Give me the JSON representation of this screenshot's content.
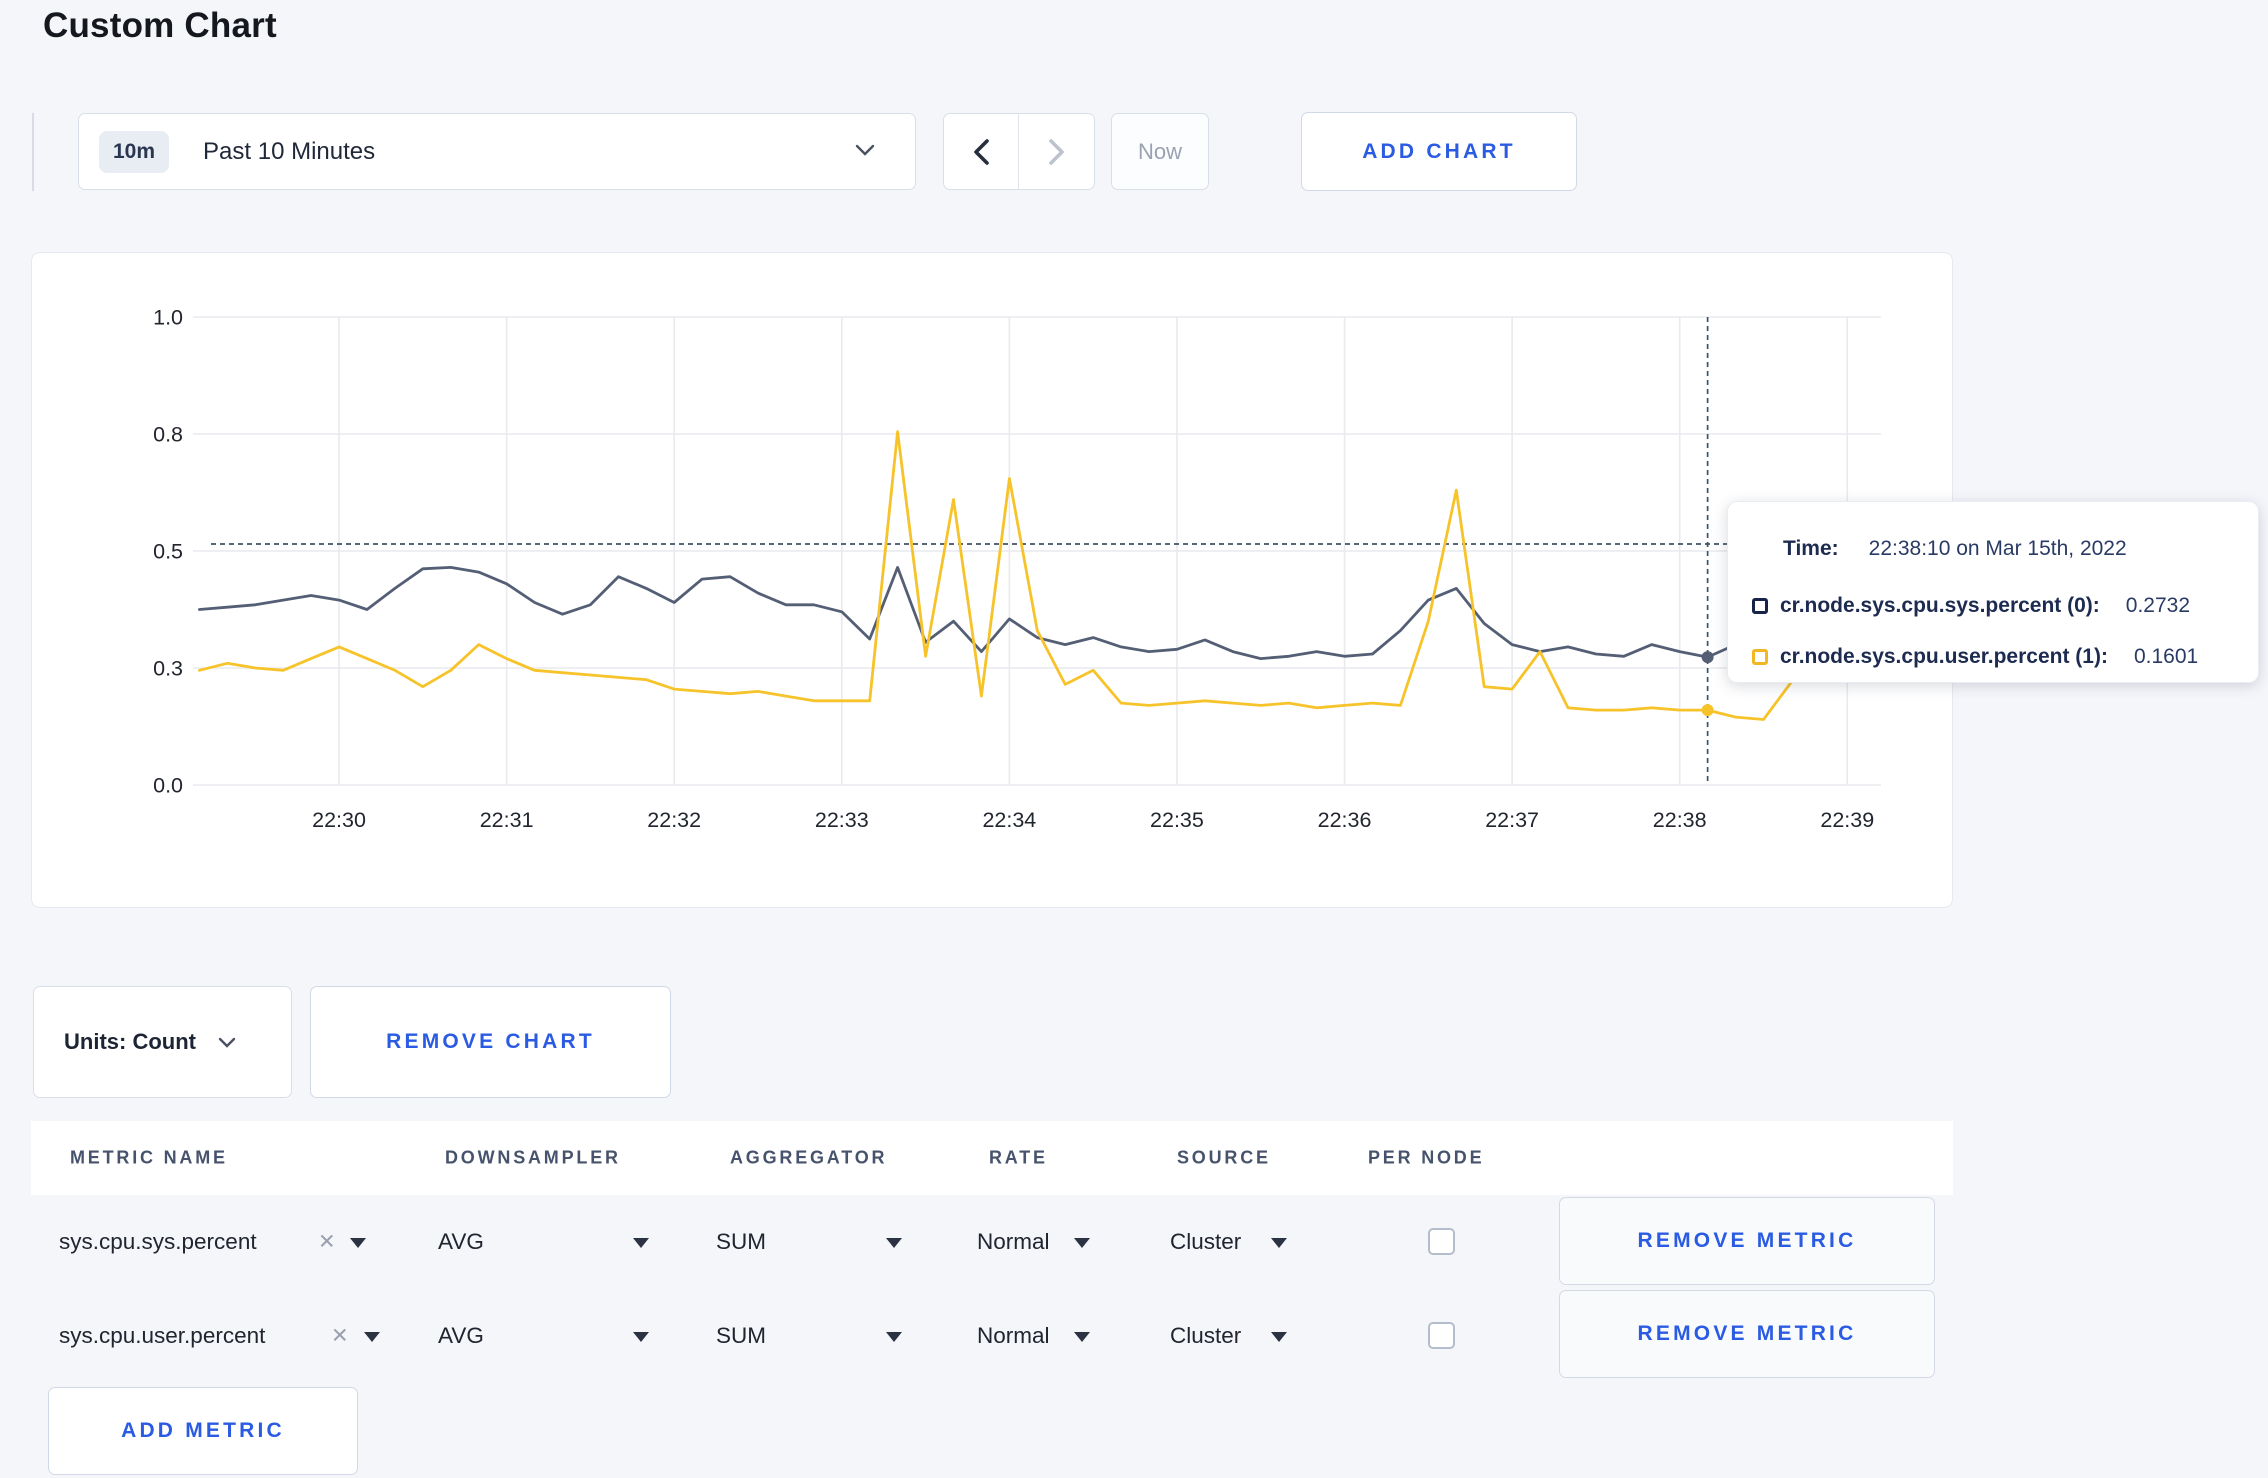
{
  "page": {
    "title": "Custom Chart",
    "background": "#f5f6fa",
    "accent_blue": "#2a5be2"
  },
  "toolbar": {
    "time_window_badge": "10m",
    "time_window_label": "Past 10 Minutes",
    "now_label": "Now",
    "add_chart_label": "ADD CHART"
  },
  "chart_controls": {
    "units_label": "Units: Count",
    "remove_chart_label": "REMOVE CHART",
    "add_metric_label": "ADD METRIC"
  },
  "tooltip": {
    "time_label": "Time:",
    "time_value": "22:38:10 on Mar 15th, 2022",
    "rows": [
      {
        "label": "cr.node.sys.cpu.sys.percent (0):",
        "value": "0.2732",
        "color": "#172449"
      },
      {
        "label": "cr.node.sys.cpu.user.percent (1):",
        "value": "0.1601",
        "color": "#f2b722"
      }
    ]
  },
  "metrics_table": {
    "headers": [
      "METRIC NAME",
      "DOWNSAMPLER",
      "AGGREGATOR",
      "RATE",
      "SOURCE",
      "PER NODE"
    ],
    "remove_metric_label": "REMOVE METRIC",
    "rows": [
      {
        "metric": "sys.cpu.sys.percent",
        "clear": "✕",
        "downsampler": "AVG",
        "aggregator": "SUM",
        "rate": "Normal",
        "source": "Cluster",
        "per_node_checked": false
      },
      {
        "metric": "sys.cpu.user.percent",
        "clear": "✕",
        "downsampler": "AVG",
        "aggregator": "SUM",
        "rate": "Normal",
        "source": "Cluster",
        "per_node_checked": false
      }
    ]
  },
  "chart_data": {
    "type": "line",
    "title": "",
    "xlabel": "",
    "ylabel": "",
    "ylim": [
      0,
      1
    ],
    "grid": true,
    "x_start_time": "22:29:10",
    "x_interval_seconds": 10,
    "x_tick_labels": [
      "22:30",
      "22:31",
      "22:32",
      "22:33",
      "22:34",
      "22:35",
      "22:36",
      "22:37",
      "22:38",
      "22:39"
    ],
    "y_ticks": [
      {
        "v": 0.0,
        "label": "0.0"
      },
      {
        "v": 0.25,
        "label": "0.3"
      },
      {
        "v": 0.5,
        "label": "0.5"
      },
      {
        "v": 0.75,
        "label": "0.8"
      },
      {
        "v": 1.0,
        "label": "1.0"
      }
    ],
    "series": [
      {
        "name": "cr.node.sys.cpu.sys.percent",
        "color": "#545f75",
        "values": [
          0.375,
          0.38,
          0.385,
          0.395,
          0.405,
          0.395,
          0.375,
          0.42,
          0.462,
          0.465,
          0.455,
          0.43,
          0.39,
          0.365,
          0.385,
          0.445,
          0.42,
          0.39,
          0.44,
          0.445,
          0.41,
          0.385,
          0.385,
          0.37,
          0.312,
          0.465,
          0.305,
          0.35,
          0.285,
          0.355,
          0.315,
          0.3,
          0.315,
          0.295,
          0.285,
          0.29,
          0.31,
          0.285,
          0.27,
          0.275,
          0.285,
          0.275,
          0.28,
          0.33,
          0.395,
          0.42,
          0.345,
          0.3,
          0.285,
          0.295,
          0.28,
          0.275,
          0.3,
          0.285,
          0.2732,
          0.3,
          0.31,
          0.3,
          0.295,
          0.3
        ]
      },
      {
        "name": "cr.node.sys.cpu.user.percent",
        "color": "#f7c32b",
        "values": [
          0.245,
          0.26,
          0.25,
          0.245,
          0.27,
          0.295,
          0.27,
          0.245,
          0.21,
          0.245,
          0.3,
          0.27,
          0.245,
          0.24,
          0.235,
          0.23,
          0.225,
          0.205,
          0.2,
          0.195,
          0.2,
          0.19,
          0.18,
          0.18,
          0.18,
          0.755,
          0.275,
          0.61,
          0.19,
          0.655,
          0.33,
          0.215,
          0.245,
          0.175,
          0.17,
          0.175,
          0.18,
          0.175,
          0.17,
          0.175,
          0.165,
          0.17,
          0.175,
          0.17,
          0.35,
          0.63,
          0.21,
          0.205,
          0.285,
          0.165,
          0.16,
          0.16,
          0.165,
          0.16,
          0.1601,
          0.145,
          0.14,
          0.22,
          0.285,
          0.235
        ]
      }
    ],
    "cursor": {
      "time": "22:38:10",
      "crosshair_y": 0.515
    },
    "legend_position": "tooltip"
  }
}
